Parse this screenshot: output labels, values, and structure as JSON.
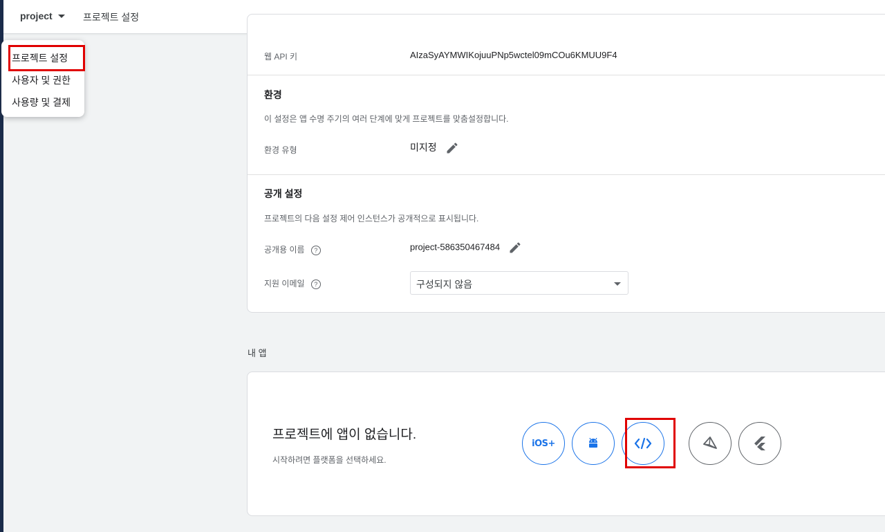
{
  "topbar": {
    "project_name": "project",
    "breadcrumb": "프로젝트 설정"
  },
  "dropdown": {
    "items": [
      {
        "label": "프로젝트 설정"
      },
      {
        "label": "사용자 및 권한"
      },
      {
        "label": "사용량 및 결제"
      }
    ]
  },
  "general": {
    "web_api_key_label": "웹 API 키",
    "web_api_key_value": "AIzaSyAYMWIKojuuPNp5wctel09mCOu6KMUU9F4"
  },
  "environment": {
    "title": "환경",
    "description": "이 설정은 앱 수명 주기의 여러 단계에 맞게 프로젝트를 맞춤설정합니다.",
    "type_label": "환경 유형",
    "type_value": "미지정"
  },
  "public_settings": {
    "title": "공개 설정",
    "description": "프로젝트의 다음 설정 제어 인스턴스가 공개적으로 표시됩니다.",
    "public_name_label": "공개용 이름",
    "public_name_value": "project-586350467484",
    "support_email_label": "지원 이메일",
    "support_email_value": "구성되지 않음",
    "help_glyph": "?"
  },
  "my_apps": {
    "heading": "내 앱",
    "empty_title": "프로젝트에 앱이 없습니다.",
    "empty_subtitle": "시작하려면 플랫폼을 선택하세요.",
    "ios_label": "iOS+",
    "platforms": [
      "ios-icon",
      "android-icon",
      "web-code-icon",
      "unity-icon",
      "flutter-icon"
    ]
  },
  "colors": {
    "accent": "#1a73e8",
    "highlight": "#e00000"
  }
}
